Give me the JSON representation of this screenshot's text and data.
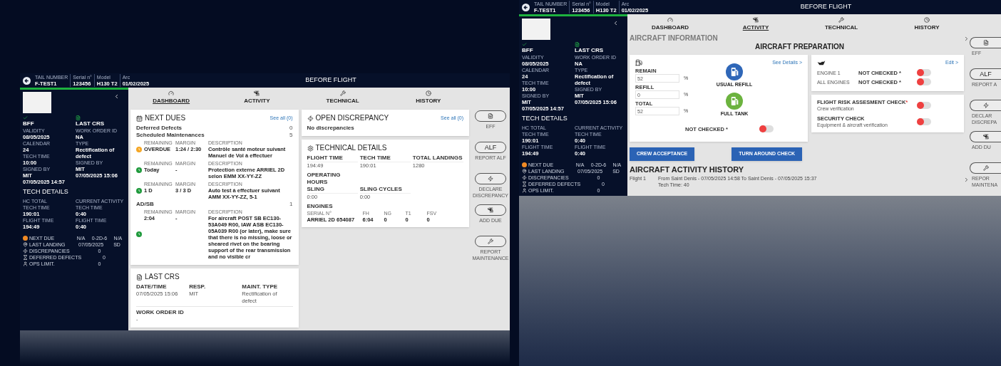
{
  "screens": [
    {
      "kind": "dashboard",
      "header": {
        "fields": [
          {
            "label": "TAIL NUMBER",
            "value": "F-TEST1"
          },
          {
            "label": "Serial n°",
            "value": "123456"
          },
          {
            "label": "Model",
            "value": "H130 T2"
          },
          {
            "label": "Arc",
            "value": "01/02/2025"
          }
        ],
        "title": "BEFORE FLIGHT"
      },
      "sidebar": {
        "bff": {
          "title": "BFF",
          "fields": [
            {
              "label": "VALIDITY",
              "value": "08/05/2025"
            },
            {
              "label": "CALENDAR",
              "value": "24"
            },
            {
              "label": "TECH TIME",
              "value": "10:00"
            },
            {
              "label": "SIGNED BY",
              "value": "MIT"
            }
          ],
          "date": "07/05/2025 14:57"
        },
        "last_crs": {
          "title": "LAST CRS",
          "fields": [
            {
              "label": "WORK ORDER ID",
              "value": "NA"
            },
            {
              "label": "TYPE",
              "value": "Rectification of defect"
            },
            {
              "label": "SIGNED BY",
              "value": "MIT"
            }
          ],
          "date": "07/05/2025 15:06"
        },
        "tech_details": {
          "title": "TECH DETAILS",
          "columns": [
            {
              "header": "HC TOTAL",
              "fields": [
                {
                  "label": "TECH TIME",
                  "value": "190:01"
                },
                {
                  "label": "FLIGHT TIME",
                  "value": "194:49"
                }
              ]
            },
            {
              "header": "CURRENT ACTIVITY",
              "fields": [
                {
                  "label": "TECH TIME",
                  "value": "0:40"
                },
                {
                  "label": "FLIGHT TIME",
                  "value": "0:40"
                }
              ]
            }
          ]
        },
        "status": [
          {
            "kind": "due",
            "label": "NEXT DUE",
            "values": [
              "N/A",
              "0-2D-6",
              "N/A"
            ]
          },
          {
            "kind": "landing",
            "label": "LAST LANDING",
            "values": [
              "07/05/2025",
              "SD"
            ]
          },
          {
            "kind": "discrepancy",
            "label": "DISCREPANCIES",
            "values": [
              "0"
            ]
          },
          {
            "kind": "deferred",
            "label": "DEFERRED DEFECTS",
            "values": [
              "0"
            ]
          },
          {
            "kind": "ops",
            "label": "OPS LIMIT.",
            "values": [
              "0"
            ]
          }
        ]
      },
      "tabs": [
        {
          "label": "DASHBOARD",
          "selected": true
        },
        {
          "label": "ACTIVITY",
          "selected": false
        },
        {
          "label": "TECHNICAL",
          "selected": false
        },
        {
          "label": "HISTORY",
          "selected": false
        }
      ],
      "actions": [
        {
          "kind": "doc",
          "label": "EFF"
        },
        {
          "kind": "text",
          "glyph": "ALF",
          "label": "REPORT ALF"
        },
        {
          "kind": "bolt",
          "label": "DECLARE DISCREPANCY"
        },
        {
          "kind": "helicopter",
          "label": "ADD DUE"
        },
        {
          "kind": "tools",
          "label": "REPORT MAINTENANCE"
        }
      ],
      "dashboard": {
        "next_dues": {
          "title": "NEXT DUES",
          "see_all": "See all (0)",
          "groups": [
            {
              "name": "Deferred Defects",
              "count": "0"
            },
            {
              "name": "Scheduled Maintenances",
              "count": "5",
              "items": [
                {
                  "color": "#f5a623",
                  "fields": [
                    {
                      "label": "REMAINING",
                      "value": "OVERDUE"
                    },
                    {
                      "label": "MARGIN",
                      "value": "1:24 / 2:30"
                    },
                    {
                      "label": "DESCRIPTION",
                      "value": "Contrôle santé moteur suivant Manuel de Vol à effectuer"
                    }
                  ]
                },
                {
                  "color": "#1f9a3c",
                  "fields": [
                    {
                      "label": "REMAINING",
                      "value": "Today"
                    },
                    {
                      "label": "MARGIN",
                      "value": "-"
                    },
                    {
                      "label": "DESCRIPTION",
                      "value": "Protection externe ARRIEL 2D selon EMM XX-YY-ZZ"
                    }
                  ]
                },
                {
                  "color": "#1f9a3c",
                  "fields": [
                    {
                      "label": "REMAINING",
                      "value": "1 D"
                    },
                    {
                      "label": "MARGIN",
                      "value": "3 / 3 D"
                    },
                    {
                      "label": "DESCRIPTION",
                      "value": "Auto test à effectuer suivant AMM XX-YY-ZZ, 5-1"
                    }
                  ]
                }
              ]
            },
            {
              "name": "AD/SB",
              "count": "1",
              "items": [
                {
                  "color": "#1f9a3c",
                  "fields": [
                    {
                      "label": "REMAINING",
                      "value": "2:04"
                    },
                    {
                      "label": "MARGIN",
                      "value": "-"
                    },
                    {
                      "label": "DESCRIPTION",
                      "value": "For aircraft POST SB EC130-53A049 R00, IAW ASB EC130-05A039 R00 (or later), make sure that there is no missing, loose or sheared rivet on the bearing support of the rear transmission and no visible cr"
                    }
                  ]
                }
              ]
            }
          ]
        },
        "last_crs": {
          "title": "LAST CRS",
          "columns": [
            {
              "label": "DATE/TIME",
              "value": "07/05/2025 15:06"
            },
            {
              "label": "RESP.",
              "value": "MIT"
            },
            {
              "label": "MAINT. TYPE",
              "value": "Rectification of defect"
            }
          ],
          "work_order": {
            "label": "WORK ORDER ID",
            "value": "-"
          }
        },
        "open_discrepancy": {
          "title": "OPEN DISCREPANCY",
          "see_all": "See all (0)",
          "message": "No discrepancies"
        },
        "technical_details": {
          "title": "TECHNICAL DETAILS",
          "rows": [
            [
              {
                "label": "FLIGHT TIME",
                "value": "194:49"
              },
              {
                "label": "TECH TIME",
                "value": "190:01"
              },
              {
                "label": "TOTAL LANDINGS",
                "value": "1280"
              }
            ],
            [
              {
                "label": "OPERATING HOURS\nSLING",
                "value": "0:00"
              },
              {
                "label": "SLING CYCLES",
                "value": "0:00"
              }
            ]
          ],
          "engines": {
            "title": "ENGINES",
            "columns": [
              {
                "label": "SERIAL N°",
                "value": "ARRIEL 2D 654087"
              },
              {
                "label": "FH",
                "value": "6:04"
              },
              {
                "label": "NG",
                "value": "0"
              },
              {
                "label": "T1",
                "value": "0"
              },
              {
                "label": "FSV",
                "value": "0"
              }
            ]
          }
        }
      }
    },
    {
      "kind": "preparation",
      "header": {
        "fields": [
          {
            "label": "TAIL NUMBER",
            "value": "F-TEST1"
          },
          {
            "label": "Serial n°",
            "value": "123456"
          },
          {
            "label": "Model",
            "value": "H130 T2"
          },
          {
            "label": "Arc",
            "value": "01/02/2025"
          }
        ],
        "title": "BEFORE FLIGHT"
      },
      "sidebar": {
        "bff": {
          "title": "BFF",
          "fields": [
            {
              "label": "VALIDITY",
              "value": "08/05/2025"
            },
            {
              "label": "CALENDAR",
              "value": "24"
            },
            {
              "label": "TECH TIME",
              "value": "10:00"
            },
            {
              "label": "SIGNED BY",
              "value": "MIT"
            }
          ],
          "date": "07/05/2025 14:57"
        },
        "last_crs": {
          "title": "LAST CRS",
          "fields": [
            {
              "label": "WORK ORDER ID",
              "value": "NA"
            },
            {
              "label": "TYPE",
              "value": "Rectification of defect"
            },
            {
              "label": "SIGNED BY",
              "value": "MIT"
            }
          ],
          "date": "07/05/2025 15:06"
        },
        "tech_details": {
          "title": "TECH DETAILS",
          "columns": [
            {
              "header": "HC TOTAL",
              "fields": [
                {
                  "label": "TECH TIME",
                  "value": "190:01"
                },
                {
                  "label": "FLIGHT TIME",
                  "value": "194:49"
                }
              ]
            },
            {
              "header": "CURRENT ACTIVITY",
              "fields": [
                {
                  "label": "TECH TIME",
                  "value": "0:40"
                },
                {
                  "label": "FLIGHT TIME",
                  "value": "0:40"
                }
              ]
            }
          ]
        },
        "status": [
          {
            "kind": "due",
            "label": "NEXT DUE",
            "values": [
              "N/A",
              "0-2D-6",
              "N/A"
            ]
          },
          {
            "kind": "landing",
            "label": "LAST LANDING",
            "values": [
              "07/05/2025",
              "SD"
            ]
          },
          {
            "kind": "discrepancy",
            "label": "DISCREPANCIES",
            "values": [
              "0"
            ]
          },
          {
            "kind": "deferred",
            "label": "DEFERRED DEFECTS",
            "values": [
              "0"
            ]
          },
          {
            "kind": "ops",
            "label": "OPS LIMIT.",
            "values": [
              "0"
            ]
          }
        ]
      },
      "tabs": [
        {
          "label": "DASHBOARD",
          "selected": false
        },
        {
          "label": "ACTIVITY",
          "selected": true
        },
        {
          "label": "TECHNICAL",
          "selected": false
        },
        {
          "label": "HISTORY",
          "selected": false
        }
      ],
      "actions": [
        {
          "kind": "doc",
          "label": "EFF"
        },
        {
          "kind": "text",
          "glyph": "ALF",
          "label": "REPORT A"
        },
        {
          "kind": "bolt",
          "label": "DECLAR DISCREPA"
        },
        {
          "kind": "helicopter",
          "label": "ADD DU"
        },
        {
          "kind": "tools",
          "label": "REPOR MAINTENA"
        }
      ],
      "preparation": {
        "info_title": "AIRCRAFT INFORMATION",
        "title": "AIRCRAFT PREPARATION",
        "fuel": {
          "link": "See Details >",
          "fields": [
            {
              "label": "REMAIN",
              "value": "52",
              "unit": "%"
            },
            {
              "label": "REFILL",
              "value": "0",
              "unit": "%"
            },
            {
              "label": "TOTAL",
              "value": "52",
              "unit": "%"
            }
          ],
          "options": [
            {
              "label": "USUAL REFILL",
              "color": "#2f67b8"
            },
            {
              "label": "FULL TANK",
              "color": "#6cb33f"
            }
          ],
          "check": {
            "label": "NOT CHECKED *",
            "on": false
          }
        },
        "engines": {
          "link": "Edit >",
          "rows": [
            {
              "label": "ENGINE 1",
              "status": "NOT CHECKED *",
              "on": false
            },
            {
              "label": "ALL ENGINES",
              "status": "NOT CHECKED *",
              "on": false
            }
          ]
        },
        "checks": [
          {
            "title": "FLIGHT RISK ASSESMENT CHECK",
            "mark": "*",
            "subtitle": "Crew verification",
            "on": false
          },
          {
            "title": "SECURITY CHECK",
            "subtitle": "Equipment & aircraft verification",
            "on": false
          }
        ],
        "buttons": [
          "CREW ACCEPTANCE",
          "TURN AROUND CHECK"
        ],
        "history": {
          "title": "AIRCRAFT ACTIVITY HISTORY",
          "items": [
            {
              "name": "Flight 1",
              "route": "From Saint Denis - 07/05/2025 14:58 To Saint Denis - 07/05/2025 15:37",
              "tech_time": "Tech Time: 40"
            }
          ]
        }
      }
    }
  ]
}
